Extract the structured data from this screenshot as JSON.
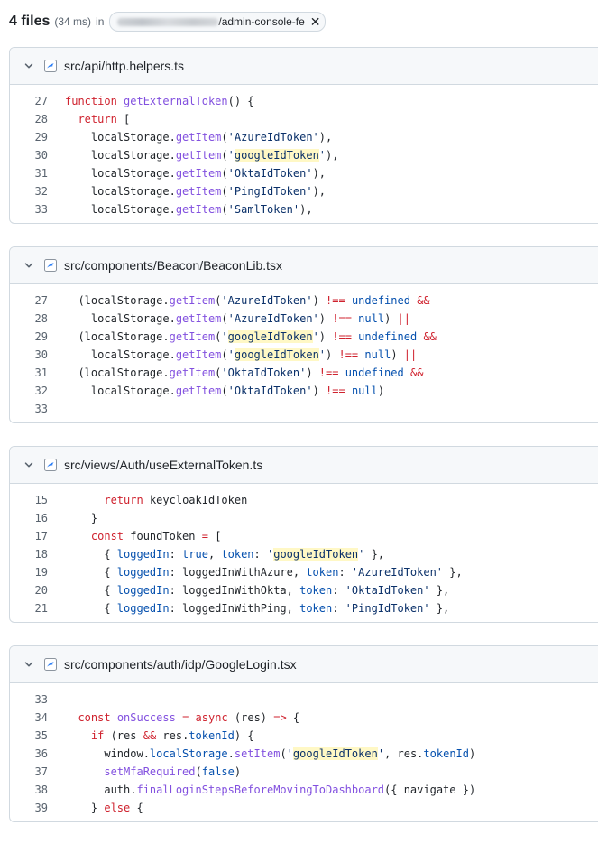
{
  "header": {
    "count": "4 files",
    "time": "(34 ms)",
    "in_label": "in",
    "repo_suffix": "/admin-console-fe"
  },
  "results": [
    {
      "path": "src/api/http.helpers.ts",
      "lines": [
        {
          "n": "27",
          "t": [
            [
              "k",
              "function "
            ],
            [
              "f",
              "getExternalToken"
            ],
            [
              "p",
              "() {"
            ]
          ]
        },
        {
          "n": "28",
          "t": [
            [
              "p",
              "  "
            ],
            [
              "k",
              "return"
            ],
            [
              "p",
              " ["
            ]
          ]
        },
        {
          "n": "29",
          "t": [
            [
              "p",
              "    localStorage."
            ],
            [
              "f",
              "getItem"
            ],
            [
              "p",
              "("
            ],
            [
              "s",
              "'AzureIdToken'"
            ],
            [
              "p",
              "),"
            ]
          ]
        },
        {
          "n": "30",
          "t": [
            [
              "p",
              "    localStorage."
            ],
            [
              "f",
              "getItem"
            ],
            [
              "p",
              "("
            ],
            [
              "s",
              "'"
            ],
            [
              "hs",
              "googleIdToken"
            ],
            [
              "s",
              "'"
            ],
            [
              "p",
              "),"
            ]
          ]
        },
        {
          "n": "31",
          "t": [
            [
              "p",
              "    localStorage."
            ],
            [
              "f",
              "getItem"
            ],
            [
              "p",
              "("
            ],
            [
              "s",
              "'OktaIdToken'"
            ],
            [
              "p",
              "),"
            ]
          ]
        },
        {
          "n": "32",
          "t": [
            [
              "p",
              "    localStorage."
            ],
            [
              "f",
              "getItem"
            ],
            [
              "p",
              "("
            ],
            [
              "s",
              "'PingIdToken'"
            ],
            [
              "p",
              "),"
            ]
          ]
        },
        {
          "n": "33",
          "t": [
            [
              "p",
              "    localStorage."
            ],
            [
              "f",
              "getItem"
            ],
            [
              "p",
              "("
            ],
            [
              "s",
              "'SamlToken'"
            ],
            [
              "p",
              "),"
            ]
          ]
        }
      ]
    },
    {
      "path": "src/components/Beacon/BeaconLib.tsx",
      "lines": [
        {
          "n": "27",
          "t": [
            [
              "p",
              "  (localStorage."
            ],
            [
              "f",
              "getItem"
            ],
            [
              "p",
              "("
            ],
            [
              "s",
              "'AzureIdToken'"
            ],
            [
              "p",
              ") "
            ],
            [
              "k",
              "!=="
            ],
            [
              "p",
              " "
            ],
            [
              "c",
              "undefined"
            ],
            [
              "p",
              " "
            ],
            [
              "k",
              "&&"
            ]
          ]
        },
        {
          "n": "28",
          "t": [
            [
              "p",
              "    localStorage."
            ],
            [
              "f",
              "getItem"
            ],
            [
              "p",
              "("
            ],
            [
              "s",
              "'AzureIdToken'"
            ],
            [
              "p",
              ") "
            ],
            [
              "k",
              "!=="
            ],
            [
              "p",
              " "
            ],
            [
              "c",
              "null"
            ],
            [
              "p",
              ") "
            ],
            [
              "k",
              "||"
            ]
          ]
        },
        {
          "n": "29",
          "t": [
            [
              "p",
              "  (localStorage."
            ],
            [
              "f",
              "getItem"
            ],
            [
              "p",
              "("
            ],
            [
              "s",
              "'"
            ],
            [
              "hs",
              "googleIdToken"
            ],
            [
              "s",
              "'"
            ],
            [
              "p",
              ") "
            ],
            [
              "k",
              "!=="
            ],
            [
              "p",
              " "
            ],
            [
              "c",
              "undefined"
            ],
            [
              "p",
              " "
            ],
            [
              "k",
              "&&"
            ]
          ]
        },
        {
          "n": "30",
          "t": [
            [
              "p",
              "    localStorage."
            ],
            [
              "f",
              "getItem"
            ],
            [
              "p",
              "("
            ],
            [
              "s",
              "'"
            ],
            [
              "hs",
              "googleIdToken"
            ],
            [
              "s",
              "'"
            ],
            [
              "p",
              ") "
            ],
            [
              "k",
              "!=="
            ],
            [
              "p",
              " "
            ],
            [
              "c",
              "null"
            ],
            [
              "p",
              ") "
            ],
            [
              "k",
              "||"
            ]
          ]
        },
        {
          "n": "31",
          "t": [
            [
              "p",
              "  (localStorage."
            ],
            [
              "f",
              "getItem"
            ],
            [
              "p",
              "("
            ],
            [
              "s",
              "'OktaIdToken'"
            ],
            [
              "p",
              ") "
            ],
            [
              "k",
              "!=="
            ],
            [
              "p",
              " "
            ],
            [
              "c",
              "undefined"
            ],
            [
              "p",
              " "
            ],
            [
              "k",
              "&&"
            ]
          ]
        },
        {
          "n": "32",
          "t": [
            [
              "p",
              "    localStorage."
            ],
            [
              "f",
              "getItem"
            ],
            [
              "p",
              "("
            ],
            [
              "s",
              "'OktaIdToken'"
            ],
            [
              "p",
              ") "
            ],
            [
              "k",
              "!=="
            ],
            [
              "p",
              " "
            ],
            [
              "c",
              "null"
            ],
            [
              "p",
              ")"
            ]
          ]
        },
        {
          "n": "33",
          "t": []
        }
      ]
    },
    {
      "path": "src/views/Auth/useExternalToken.ts",
      "lines": [
        {
          "n": "15",
          "t": [
            [
              "p",
              "      "
            ],
            [
              "k",
              "return"
            ],
            [
              "p",
              " keycloakIdToken"
            ]
          ]
        },
        {
          "n": "16",
          "t": [
            [
              "p",
              "    }"
            ]
          ]
        },
        {
          "n": "17",
          "t": [
            [
              "p",
              "    "
            ],
            [
              "k",
              "const"
            ],
            [
              "p",
              " foundToken "
            ],
            [
              "k",
              "="
            ],
            [
              "p",
              " ["
            ]
          ]
        },
        {
          "n": "18",
          "t": [
            [
              "p",
              "      { "
            ],
            [
              "c",
              "loggedIn"
            ],
            [
              "p",
              ": "
            ],
            [
              "c",
              "true"
            ],
            [
              "p",
              ", "
            ],
            [
              "c",
              "token"
            ],
            [
              "p",
              ": "
            ],
            [
              "s",
              "'"
            ],
            [
              "hs",
              "googleIdToken"
            ],
            [
              "s",
              "'"
            ],
            [
              "p",
              " },"
            ]
          ]
        },
        {
          "n": "19",
          "t": [
            [
              "p",
              "      { "
            ],
            [
              "c",
              "loggedIn"
            ],
            [
              "p",
              ": loggedInWithAzure, "
            ],
            [
              "c",
              "token"
            ],
            [
              "p",
              ": "
            ],
            [
              "s",
              "'AzureIdToken'"
            ],
            [
              "p",
              " },"
            ]
          ]
        },
        {
          "n": "20",
          "t": [
            [
              "p",
              "      { "
            ],
            [
              "c",
              "loggedIn"
            ],
            [
              "p",
              ": loggedInWithOkta, "
            ],
            [
              "c",
              "token"
            ],
            [
              "p",
              ": "
            ],
            [
              "s",
              "'OktaIdToken'"
            ],
            [
              "p",
              " },"
            ]
          ]
        },
        {
          "n": "21",
          "t": [
            [
              "p",
              "      { "
            ],
            [
              "c",
              "loggedIn"
            ],
            [
              "p",
              ": loggedInWithPing, "
            ],
            [
              "c",
              "token"
            ],
            [
              "p",
              ": "
            ],
            [
              "s",
              "'PingIdToken'"
            ],
            [
              "p",
              " },"
            ]
          ]
        }
      ]
    },
    {
      "path": "src/components/auth/idp/GoogleLogin.tsx",
      "lines": [
        {
          "n": "33",
          "t": []
        },
        {
          "n": "34",
          "t": [
            [
              "p",
              "  "
            ],
            [
              "k",
              "const"
            ],
            [
              "p",
              " "
            ],
            [
              "f",
              "onSuccess"
            ],
            [
              "p",
              " "
            ],
            [
              "k",
              "="
            ],
            [
              "p",
              " "
            ],
            [
              "k",
              "async"
            ],
            [
              "p",
              " (res) "
            ],
            [
              "k",
              "=>"
            ],
            [
              "p",
              " {"
            ]
          ]
        },
        {
          "n": "35",
          "t": [
            [
              "p",
              "    "
            ],
            [
              "k",
              "if"
            ],
            [
              "p",
              " (res "
            ],
            [
              "k",
              "&&"
            ],
            [
              "p",
              " res."
            ],
            [
              "c",
              "tokenId"
            ],
            [
              "p",
              ") {"
            ]
          ]
        },
        {
          "n": "36",
          "t": [
            [
              "p",
              "      window."
            ],
            [
              "c",
              "localStorage"
            ],
            [
              "p",
              "."
            ],
            [
              "f",
              "setItem"
            ],
            [
              "p",
              "("
            ],
            [
              "s",
              "'"
            ],
            [
              "hs",
              "googleIdToken"
            ],
            [
              "s",
              "'"
            ],
            [
              "p",
              ", res."
            ],
            [
              "c",
              "tokenId"
            ],
            [
              "p",
              ")"
            ]
          ]
        },
        {
          "n": "37",
          "t": [
            [
              "p",
              "      "
            ],
            [
              "f",
              "setMfaRequired"
            ],
            [
              "p",
              "("
            ],
            [
              "c",
              "false"
            ],
            [
              "p",
              ")"
            ]
          ]
        },
        {
          "n": "38",
          "t": [
            [
              "p",
              "      auth."
            ],
            [
              "f",
              "finalLoginStepsBeforeMovingToDashboard"
            ],
            [
              "p",
              "({ navigate })"
            ]
          ]
        },
        {
          "n": "39",
          "t": [
            [
              "p",
              "    } "
            ],
            [
              "k",
              "else"
            ],
            [
              "p",
              " {"
            ]
          ]
        }
      ]
    }
  ]
}
